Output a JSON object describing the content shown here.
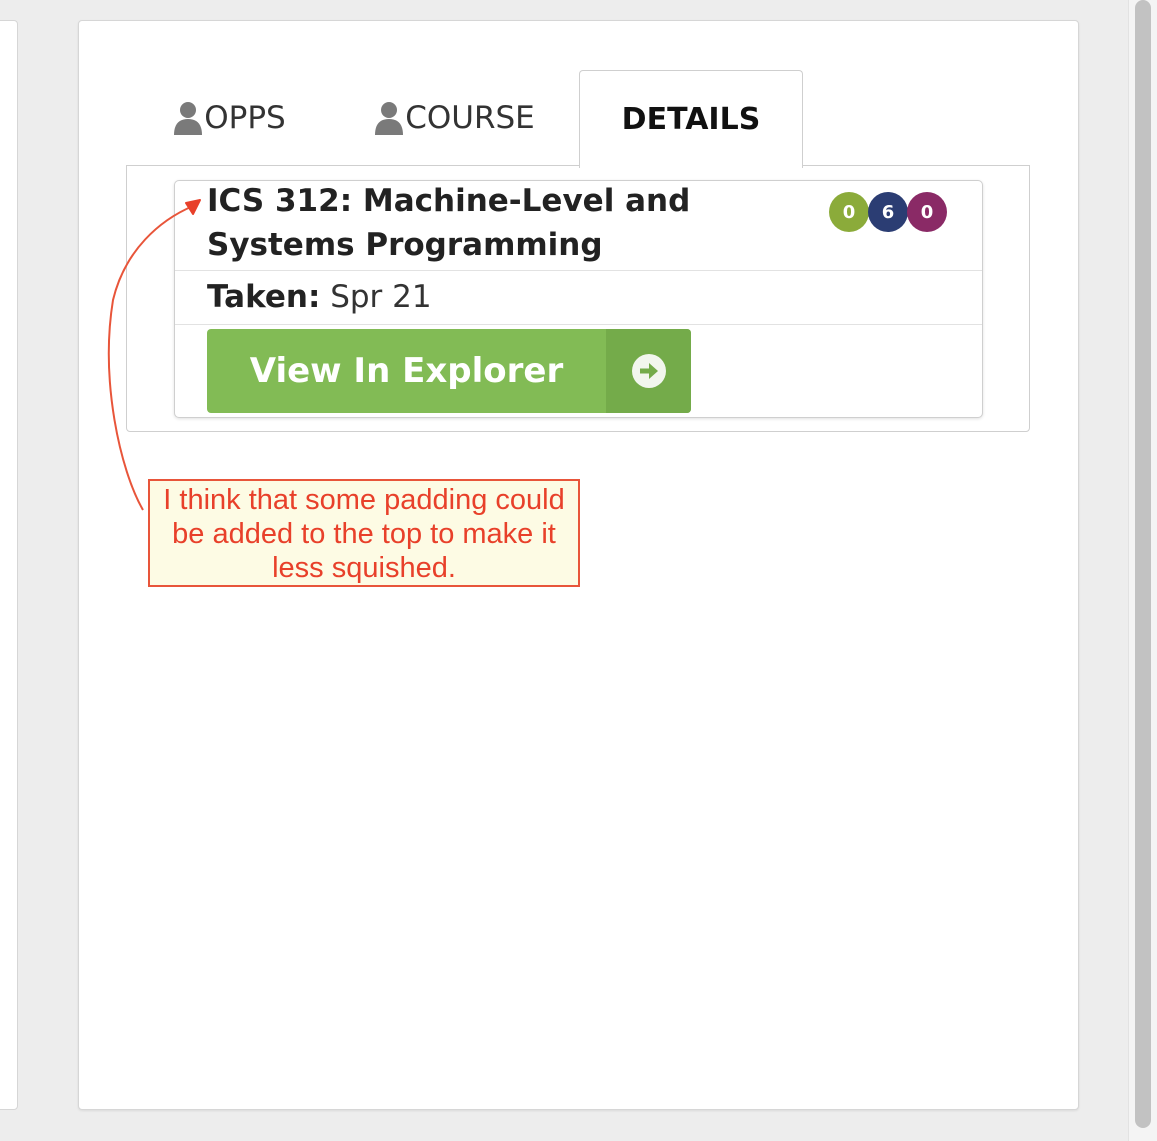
{
  "tabs": [
    {
      "label": "OPPS"
    },
    {
      "label": "COURSE"
    },
    {
      "label": "DETAILS"
    }
  ],
  "course": {
    "title": "ICS 312: Machine-Level and Systems Programming",
    "badges": [
      {
        "value": "0",
        "color": "#8bab3a"
      },
      {
        "value": "6",
        "color": "#2b3d73"
      },
      {
        "value": "0",
        "color": "#8a2a66"
      }
    ],
    "taken_label": "Taken:",
    "taken_value": "Spr 21",
    "explorer_button": "View In Explorer"
  },
  "annotation": {
    "text": "I think that some padding could be added to the top to make it less squished.",
    "color": "#e8402a"
  },
  "icons": {
    "tab_icon": "person-icon",
    "button_icon": "arrow-circle-right-icon"
  }
}
